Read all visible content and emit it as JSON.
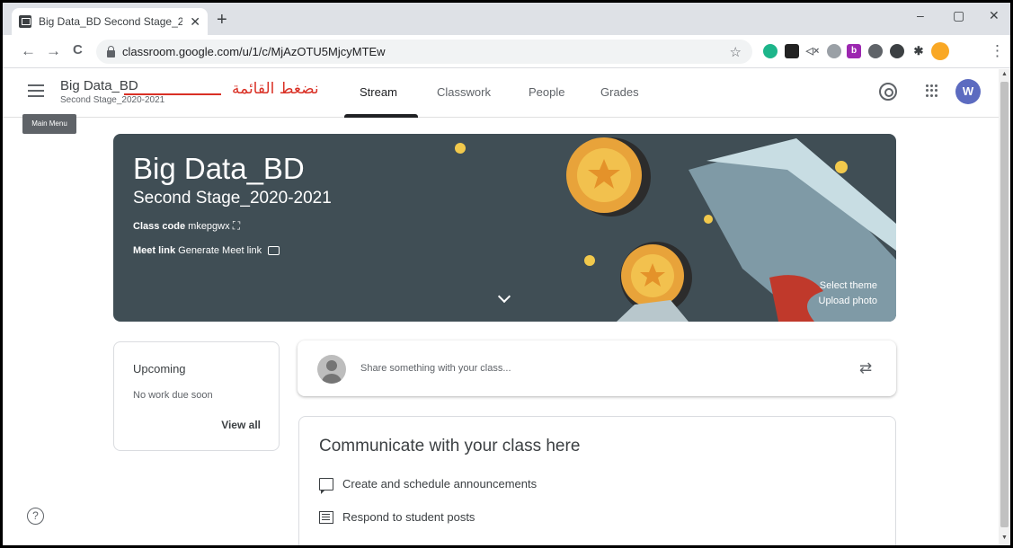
{
  "browser": {
    "tab_title": "Big Data_BD Second Stage_2020",
    "tab_close": "✕",
    "new_tab": "+",
    "url": "classroom.google.com/u/1/c/MjAzOTU5MjcyMTEw",
    "minimize": "–",
    "maximize": "▢",
    "close": "✕",
    "back": "←",
    "forward": "→",
    "reload": "C",
    "bookmark": "☆",
    "menu": "⋮"
  },
  "header": {
    "class_name": "Big Data_BD",
    "class_section": "Second Stage_2020-2021",
    "annotation": "نضغط القائمة",
    "tabs": [
      {
        "label": "Stream"
      },
      {
        "label": "Classwork"
      },
      {
        "label": "People"
      },
      {
        "label": "Grades"
      }
    ],
    "avatar_letter": "W",
    "tooltip": "Main Menu"
  },
  "banner": {
    "title": "Big Data_BD",
    "subtitle": "Second Stage_2020-2021",
    "class_code_label": "Class code",
    "class_code": "mkepgwx",
    "meet_label": "Meet link",
    "meet_action": "Generate Meet link",
    "select_theme": "Select theme",
    "upload_photo": "Upload photo",
    "bg_color": "#404e55"
  },
  "upcoming": {
    "title": "Upcoming",
    "empty": "No work due soon",
    "view_all": "View all"
  },
  "share": {
    "placeholder": "Share something with your class..."
  },
  "communicate": {
    "title": "Communicate with your class here",
    "items": [
      {
        "label": "Create and schedule announcements"
      },
      {
        "label": "Respond to student posts"
      }
    ]
  },
  "help": "?"
}
